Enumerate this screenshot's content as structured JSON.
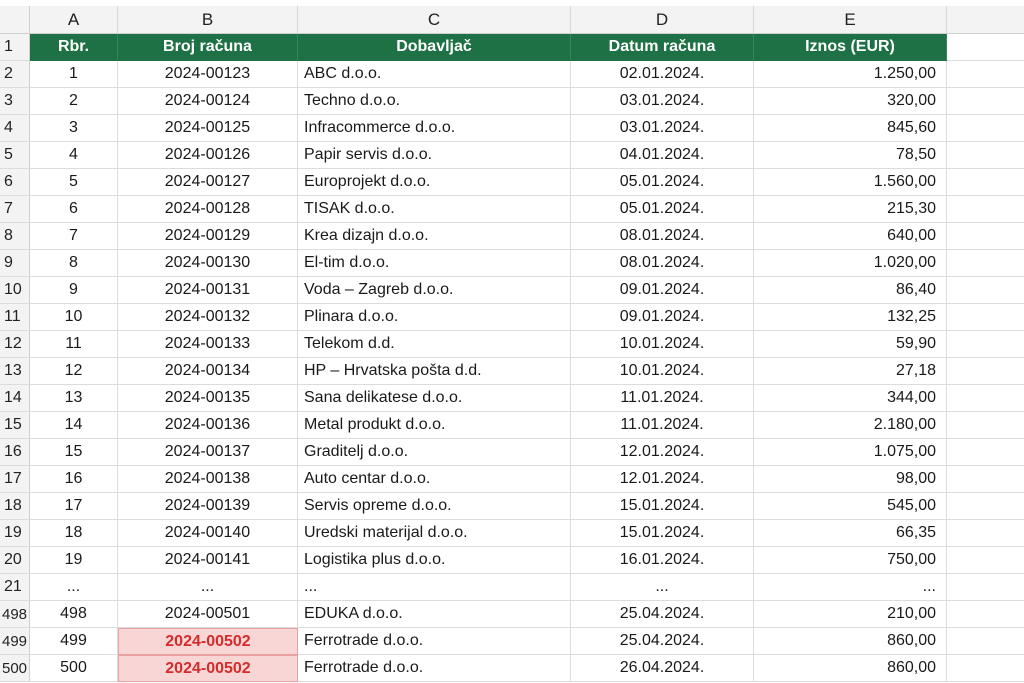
{
  "columns": [
    "A",
    "B",
    "C",
    "D",
    "E"
  ],
  "header": {
    "row_number": "1",
    "rbr": "Rbr.",
    "broj": "Broj računa",
    "dobavljac": "Dobavljač",
    "datum": "Datum računa",
    "iznos": "Iznos (EUR)"
  },
  "rows": [
    {
      "rn": "2",
      "rbr": "1",
      "broj": "2024-00123",
      "dobavljac": "ABC d.o.o.",
      "datum": "02.01.2024.",
      "iznos": "1.250,00"
    },
    {
      "rn": "3",
      "rbr": "2",
      "broj": "2024-00124",
      "dobavljac": "Techno d.o.o.",
      "datum": "03.01.2024.",
      "iznos": "320,00"
    },
    {
      "rn": "4",
      "rbr": "3",
      "broj": "2024-00125",
      "dobavljac": "Infracommerce d.o.o.",
      "datum": "03.01.2024.",
      "iznos": "845,60"
    },
    {
      "rn": "5",
      "rbr": "4",
      "broj": "2024-00126",
      "dobavljac": "Papir servis d.o.o.",
      "datum": "04.01.2024.",
      "iznos": "78,50"
    },
    {
      "rn": "6",
      "rbr": "5",
      "broj": "2024-00127",
      "dobavljac": "Europrojekt d.o.o.",
      "datum": "05.01.2024.",
      "iznos": "1.560,00"
    },
    {
      "rn": "7",
      "rbr": "6",
      "broj": "2024-00128",
      "dobavljac": "TISAK d.o.o.",
      "datum": "05.01.2024.",
      "iznos": "215,30"
    },
    {
      "rn": "8",
      "rbr": "7",
      "broj": "2024-00129",
      "dobavljac": "Krea dizajn d.o.o.",
      "datum": "08.01.2024.",
      "iznos": "640,00"
    },
    {
      "rn": "9",
      "rbr": "8",
      "broj": "2024-00130",
      "dobavljac": "El-tim d.o.o.",
      "datum": "08.01.2024.",
      "iznos": "1.020,00"
    },
    {
      "rn": "10",
      "rbr": "9",
      "broj": "2024-00131",
      "dobavljac": "Voda – Zagreb d.o.o.",
      "datum": "09.01.2024.",
      "iznos": "86,40"
    },
    {
      "rn": "11",
      "rbr": "10",
      "broj": "2024-00132",
      "dobavljac": "Plinara d.o.o.",
      "datum": "09.01.2024.",
      "iznos": "132,25"
    },
    {
      "rn": "12",
      "rbr": "11",
      "broj": "2024-00133",
      "dobavljac": "Telekom d.d.",
      "datum": "10.01.2024.",
      "iznos": "59,90"
    },
    {
      "rn": "13",
      "rbr": "12",
      "broj": "2024-00134",
      "dobavljac": "HP – Hrvatska pošta d.d.",
      "datum": "10.01.2024.",
      "iznos": "27,18"
    },
    {
      "rn": "14",
      "rbr": "13",
      "broj": "2024-00135",
      "dobavljac": "Sana delikatese d.o.o.",
      "datum": "11.01.2024.",
      "iznos": "344,00"
    },
    {
      "rn": "15",
      "rbr": "14",
      "broj": "2024-00136",
      "dobavljac": "Metal produkt d.o.o.",
      "datum": "11.01.2024.",
      "iznos": "2.180,00"
    },
    {
      "rn": "16",
      "rbr": "15",
      "broj": "2024-00137",
      "dobavljac": "Graditelj d.o.o.",
      "datum": "12.01.2024.",
      "iznos": "1.075,00"
    },
    {
      "rn": "17",
      "rbr": "16",
      "broj": "2024-00138",
      "dobavljac": "Auto centar d.o.o.",
      "datum": "12.01.2024.",
      "iznos": "98,00"
    },
    {
      "rn": "18",
      "rbr": "17",
      "broj": "2024-00139",
      "dobavljac": "Servis opreme d.o.o.",
      "datum": "15.01.2024.",
      "iznos": "545,00"
    },
    {
      "rn": "19",
      "rbr": "18",
      "broj": "2024-00140",
      "dobavljac": "Uredski materijal d.o.o.",
      "datum": "15.01.2024.",
      "iznos": "66,35"
    },
    {
      "rn": "20",
      "rbr": "19",
      "broj": "2024-00141",
      "dobavljac": "Logistika plus d.o.o.",
      "datum": "16.01.2024.",
      "iznos": "750,00"
    },
    {
      "rn": "21",
      "rbr": "...",
      "broj": "...",
      "dobavljac": "...",
      "datum": "...",
      "iznos": "..."
    },
    {
      "rn": "498",
      "rbr": "498",
      "broj": "2024-00501",
      "dobavljac": "EDUKA d.o.o.",
      "datum": "25.04.2024.",
      "iznos": "210,00"
    },
    {
      "rn": "499",
      "rbr": "499",
      "broj": "2024-00502",
      "dobavljac": "Ferrotrade d.o.o.",
      "datum": "25.04.2024.",
      "iznos": "860,00",
      "duplicate": true
    },
    {
      "rn": "500",
      "rbr": "500",
      "broj": "2024-00502",
      "dobavljac": "Ferrotrade d.o.o.",
      "datum": "26.04.2024.",
      "iznos": "860,00",
      "duplicate": true
    }
  ],
  "colors": {
    "header_bg": "#1e7144",
    "header_text": "#ffffff",
    "duplicate_bg": "#f9d6d6",
    "duplicate_text": "#d42b2b"
  }
}
